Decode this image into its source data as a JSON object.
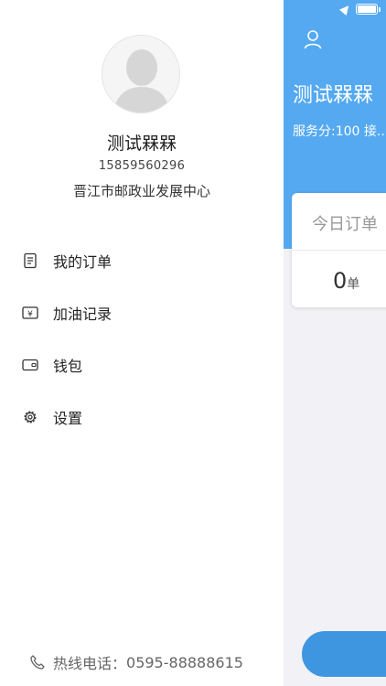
{
  "drawer": {
    "user": {
      "name": "测试槑槑",
      "phone": "15859560296",
      "organization": "晋江市邮政业发展中心"
    },
    "menu": [
      {
        "label": "我的订单",
        "icon": "order-list-icon"
      },
      {
        "label": "加油记录",
        "icon": "fuel-record-icon"
      },
      {
        "label": "钱包",
        "icon": "wallet-icon"
      },
      {
        "label": "设置",
        "icon": "settings-gear-icon"
      }
    ],
    "hotline": {
      "label": "热线电话：",
      "number": "0595-88888615"
    }
  },
  "background_page": {
    "title": "测试槑槑",
    "subtitle": "服务分:100  接...",
    "card": {
      "title": "今日订单",
      "count": "0",
      "unit": "单"
    },
    "colors": {
      "header": "#54a9f1",
      "button": "#3e96e0"
    }
  }
}
